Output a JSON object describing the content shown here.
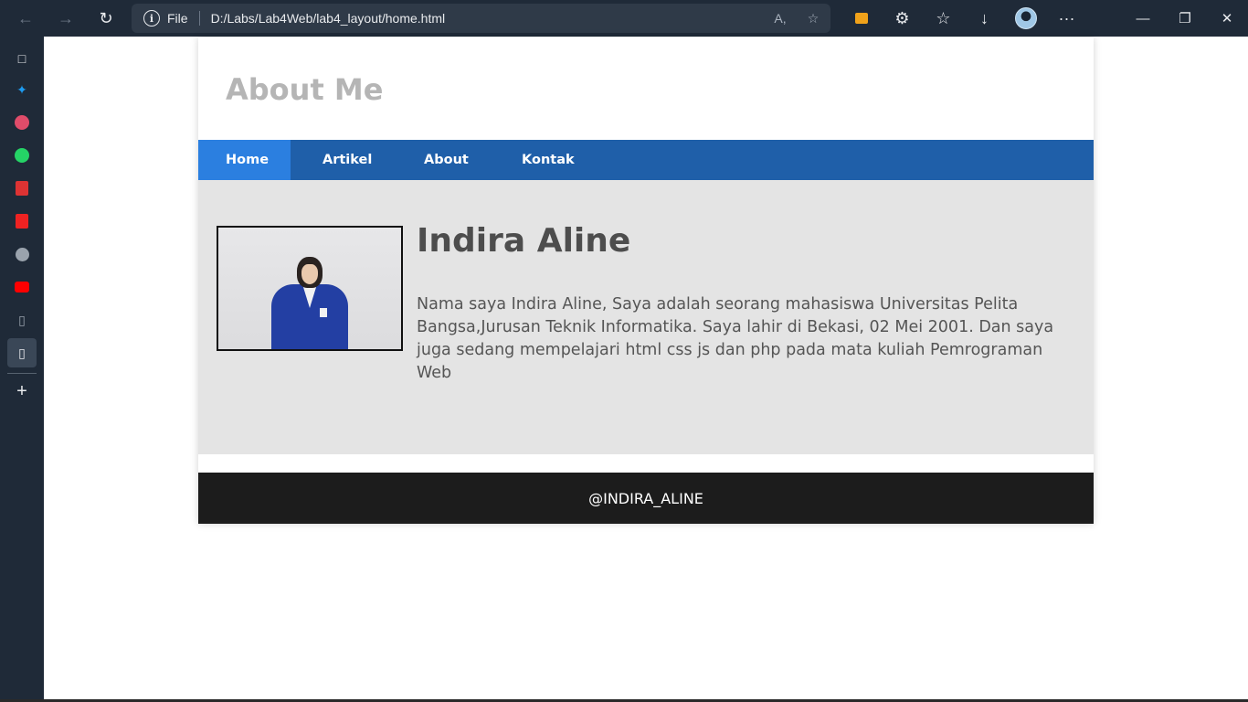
{
  "browser": {
    "address": {
      "scheme_label": "File",
      "url": "D:/Labs/Lab4Web/lab4_layout/home.html"
    },
    "icons": {
      "back": "arrow-left-icon",
      "forward": "arrow-right-icon",
      "refresh": "refresh-icon",
      "info": "info-icon",
      "read_aloud": "read-aloud-icon",
      "add_favorite": "star-plus-icon",
      "extension": "extension-icon",
      "puzzle": "puzzle-icon",
      "favorites": "favorites-icon",
      "downloads": "download-icon",
      "profile": "avatar",
      "more": "more-icon",
      "minimize": "minimize-icon",
      "restore": "restore-icon",
      "close": "close-icon"
    }
  },
  "sidebar": {
    "items": [
      "tab-actions-icon",
      "twitter-icon",
      "messenger-icon",
      "whatsapp-icon",
      "pdf-icon",
      "pdf-icon",
      "github-icon",
      "youtube-icon",
      "file-icon",
      "file-icon"
    ],
    "add": "plus-icon"
  },
  "page": {
    "header": {
      "title": "About Me"
    },
    "nav": [
      {
        "label": "Home",
        "active": true
      },
      {
        "label": "Artikel",
        "active": false
      },
      {
        "label": "About",
        "active": false
      },
      {
        "label": "Kontak",
        "active": false
      }
    ],
    "profile": {
      "name": "Indira Aline",
      "description": "Nama saya Indira Aline, Saya adalah seorang mahasiswa Universitas Pelita Bangsa,Jurusan Teknik Informatika. Saya lahir di Bekasi, 02 Mei 2001. Dan saya juga sedang mempelajari html css js dan php pada mata kuliah Pemrograman Web"
    },
    "footer": {
      "text": "@INDIRA_ALINE"
    }
  },
  "colors": {
    "nav_bg": "#1f5fa9",
    "nav_active": "#2b7fe0",
    "content_bg": "#e4e4e4",
    "footer_bg": "#1c1c1c",
    "title": "#b5b5b5"
  }
}
